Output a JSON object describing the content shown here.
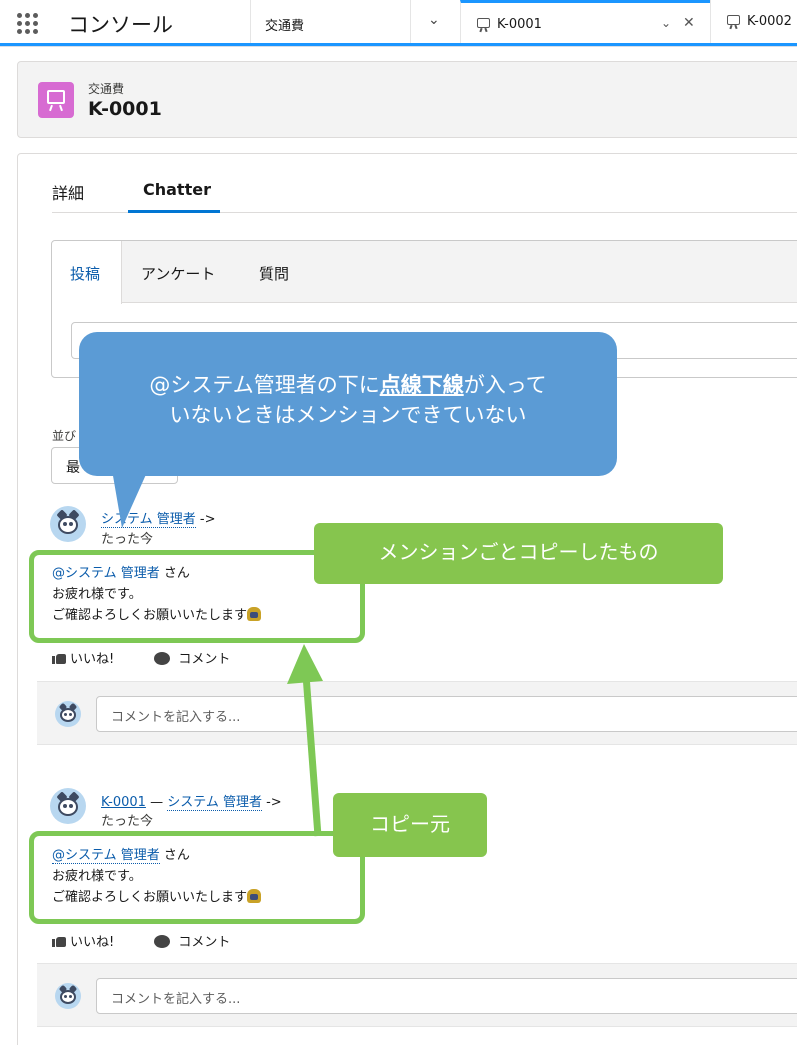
{
  "app": {
    "name": "コンソール",
    "nav_home": "交通費",
    "tabs": [
      {
        "label": "K-0001"
      },
      {
        "label": "K-0002"
      }
    ]
  },
  "record": {
    "type": "交通費",
    "name": "K-0001"
  },
  "record_tabs": {
    "details": "詳細",
    "chatter": "Chatter"
  },
  "publisher": {
    "tabs": [
      "投稿",
      "アンケート",
      "質問"
    ]
  },
  "sort": {
    "label": "並び",
    "value": "最"
  },
  "feed": [
    {
      "author": "システム 管理者",
      "arrow": "->",
      "time": "たった今",
      "mention": "@システム 管理者",
      "san": " さん",
      "line2": "お疲れ様です。",
      "line3": "ご確認よろしくお願いいたします",
      "like": "いいね!",
      "comment": "コメント",
      "comment_placeholder": "コメントを記入する..."
    },
    {
      "record_link": "K-0001",
      "dash": " — ",
      "author": "システム 管理者",
      "arrow": "->",
      "time": "たった今",
      "mention": "@システム 管理者",
      "san": " さん",
      "line2": "お疲れ様です。",
      "line3": "ご確認よろしくお願いいたします",
      "like": "いいね!",
      "comment": "コメント",
      "comment_placeholder": "コメントを記入する..."
    }
  ],
  "annotations": {
    "bubble_line1_a": "@システム管理者の下に",
    "bubble_bold": "点線下線",
    "bubble_line1_b": "が入って",
    "bubble_line2": "いないときはメンションできていない",
    "label_copy": "メンションごとコピーしたもの",
    "label_source": "コピー元"
  },
  "colors": {
    "accent": "#1b96ff",
    "record_icon": "#d76bd2",
    "annotation_green": "#7ec855",
    "annotation_blue": "#5b9bd5",
    "link": "#0b5cab"
  }
}
